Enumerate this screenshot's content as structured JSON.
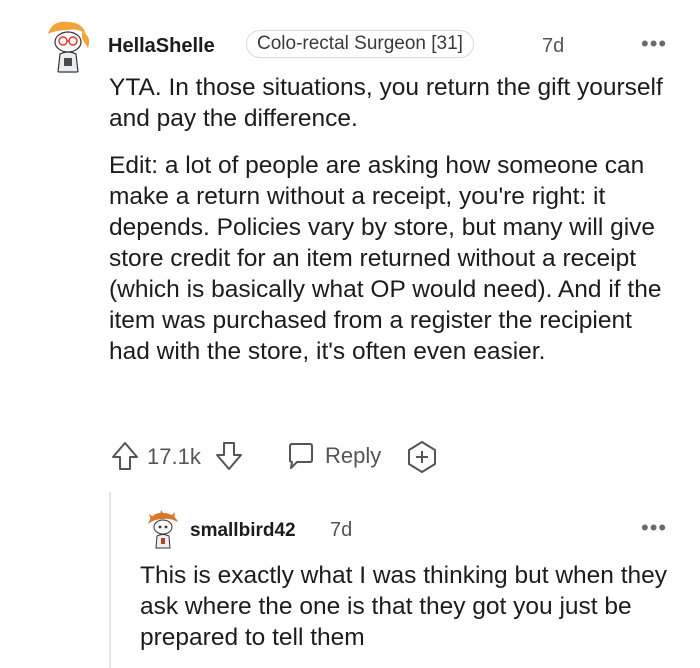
{
  "comment": {
    "username": "HellaShelle",
    "flair": "Colo-rectal Surgeon [31]",
    "age": "7d",
    "more": "•••",
    "paragraphs": [
      "YTA. In those situations, you return the gift yourself and pay the difference.",
      "Edit: a lot of people are asking how someone can make a return without a receipt, you're right: it depends. Policies vary by store, but many will give store credit for an item returned without a receipt (which is basically what OP would need). And if the item was purchased from a register the recipient had with the store, it's often even easier."
    ],
    "votes": "17.1k",
    "reply_label": "Reply",
    "icons": [
      "upvote-icon",
      "downvote-icon",
      "reply-icon",
      "award-icon",
      "more-icon"
    ]
  },
  "reply": {
    "username": "smallbird42",
    "age": "7d",
    "more": "•••",
    "text": "This is exactly what I was thinking but when they ask where the one is that they got you just be prepared to tell them"
  },
  "colors": {
    "text": "#1c1c1c",
    "muted": "#555555",
    "border": "#d7d7d7",
    "avatar_accent": "#f2a33a"
  }
}
